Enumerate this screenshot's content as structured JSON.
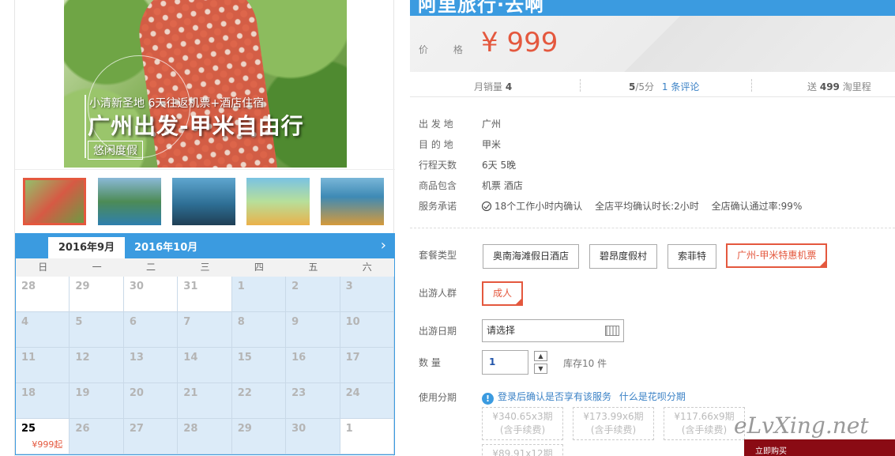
{
  "hero": {
    "subtitle": "小清新圣地 6天往返机票+酒店住宿",
    "title": "广州出发-甲米自由行",
    "tag": "悠闲度假"
  },
  "calendar": {
    "tabs": [
      "2016年9月",
      "2016年10月"
    ],
    "weekdays": [
      "日",
      "一",
      "二",
      "三",
      "四",
      "五",
      "六"
    ],
    "days": [
      "28",
      "29",
      "30",
      "31",
      "1",
      "2",
      "3",
      "4",
      "5",
      "6",
      "7",
      "8",
      "9",
      "10",
      "11",
      "12",
      "13",
      "14",
      "15",
      "16",
      "17",
      "18",
      "19",
      "20",
      "21",
      "22",
      "23",
      "24",
      "25",
      "26",
      "27",
      "28",
      "29",
      "30",
      "1"
    ],
    "active_price": "¥999起",
    "next_icon": "chevron-right-icon"
  },
  "product": {
    "title_partial": "阿里旅行·去啊",
    "price_label": "价 格",
    "price": "¥ 999",
    "monthly_sales_label": "月销量",
    "monthly_sales": "4",
    "rating": "5",
    "rating_suffix": "/5分",
    "reviews_link": "1 条评论",
    "points_prefix": "送",
    "points": "499",
    "points_suffix": "淘里程"
  },
  "info": {
    "rows": [
      {
        "label": "出 发 地",
        "value": "广州"
      },
      {
        "label": "目 的 地",
        "value": "甲米"
      },
      {
        "label": "行程天数",
        "value": "6天 5晚"
      },
      {
        "label": "商品包含",
        "value": "机票 酒店"
      }
    ],
    "service_label": "服务承诺",
    "service_items": [
      "18个工作小时内确认",
      "全店平均确认时长:2小时",
      "全店确认通过率:99%"
    ]
  },
  "options": {
    "package_label": "套餐类型",
    "packages": [
      "奥南海滩假日酒店",
      "碧昂度假村",
      "索菲特",
      "广州-甲米特惠机票"
    ],
    "people_label": "出游人群",
    "people": [
      "成人"
    ],
    "date_label": "出游日期",
    "date_placeholder": "请选择",
    "qty_label": "数 量",
    "qty_value": "1",
    "stock": "库存10 件",
    "installment_label": "使用分期",
    "login_tip": "登录后确认是否享有该服务",
    "installment_link": "什么是花呗分期",
    "installments": [
      {
        "amount": "¥340.65x3期",
        "note": "(含手续费)"
      },
      {
        "amount": "¥173.99x6期",
        "note": "(含手续费)"
      },
      {
        "amount": "¥117.66x9期",
        "note": "(含手续费)"
      },
      {
        "amount": "¥89.91x12期",
        "note": ""
      }
    ]
  },
  "watermark": "eLvXing.net",
  "buy_bar": "立即购买",
  "colors": {
    "accent": "#3b9be0",
    "price": "#e4583e",
    "link": "#3b82c6"
  }
}
